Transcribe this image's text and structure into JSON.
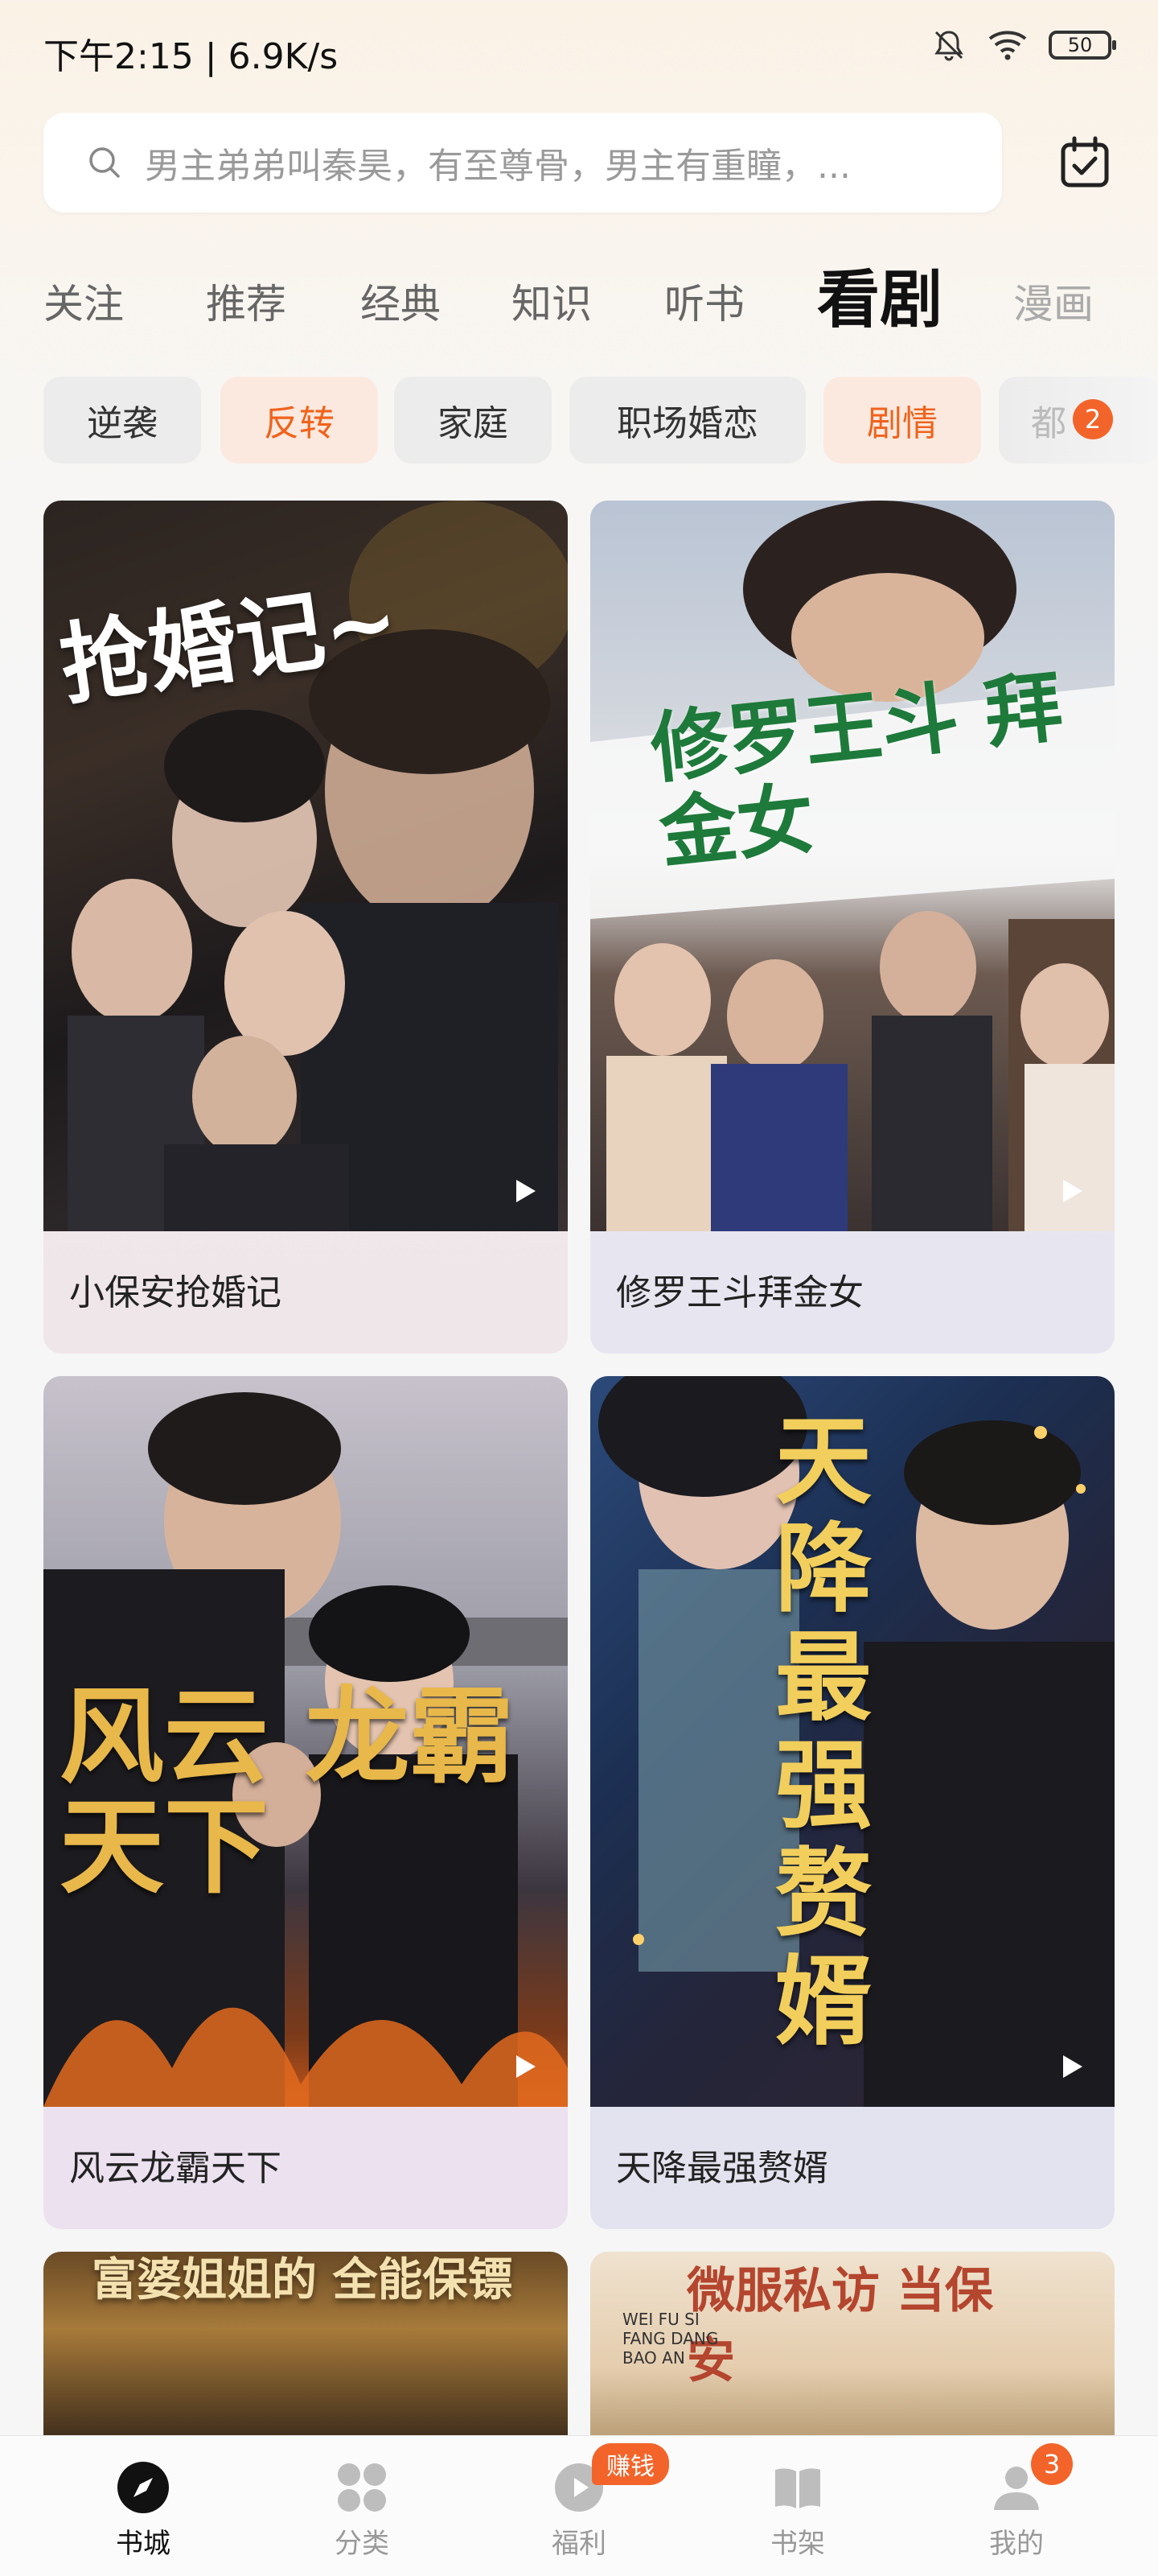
{
  "status": {
    "time": "下午2:15 | 6.9K/s",
    "battery": "50"
  },
  "search": {
    "placeholder": "男主弟弟叫秦昊，有至尊骨，男主有重瞳，..."
  },
  "tabs": [
    "关注",
    "推荐",
    "经典",
    "知识",
    "听书",
    "看剧",
    "漫画"
  ],
  "active_tab": "看剧",
  "chips": [
    "逆袭",
    "反转",
    "家庭",
    "职场婚恋",
    "剧情",
    "都"
  ],
  "chip_badge": "2",
  "cards": [
    {
      "title": "小保安抢婚记",
      "cover_text": "抢婚记~"
    },
    {
      "title": "修罗王斗拜金女",
      "cover_text": "修罗王斗 拜金女"
    },
    {
      "title": "风云龙霸天下",
      "cover_text": "风云 龙霸天下"
    },
    {
      "title": "天降最强赘婿",
      "cover_text": "天降 最强 赘婿"
    }
  ],
  "partial_cards": [
    {
      "cover_text": "富婆姐姐的 全能保镖"
    },
    {
      "cover_text": "微服私访 当保安",
      "sub_text": "WEI FU SI FANG DANG BAO AN"
    }
  ],
  "nav": [
    {
      "label": "书城",
      "icon": "compass-icon"
    },
    {
      "label": "分类",
      "icon": "grid-icon"
    },
    {
      "label": "福利",
      "icon": "gift-icon"
    },
    {
      "label": "书架",
      "icon": "book-icon"
    },
    {
      "label": "我的",
      "icon": "user-icon"
    }
  ],
  "nav_earn_badge": "赚钱",
  "nav_mine_badge": "3",
  "colors": {
    "accent": "#f3642a"
  }
}
